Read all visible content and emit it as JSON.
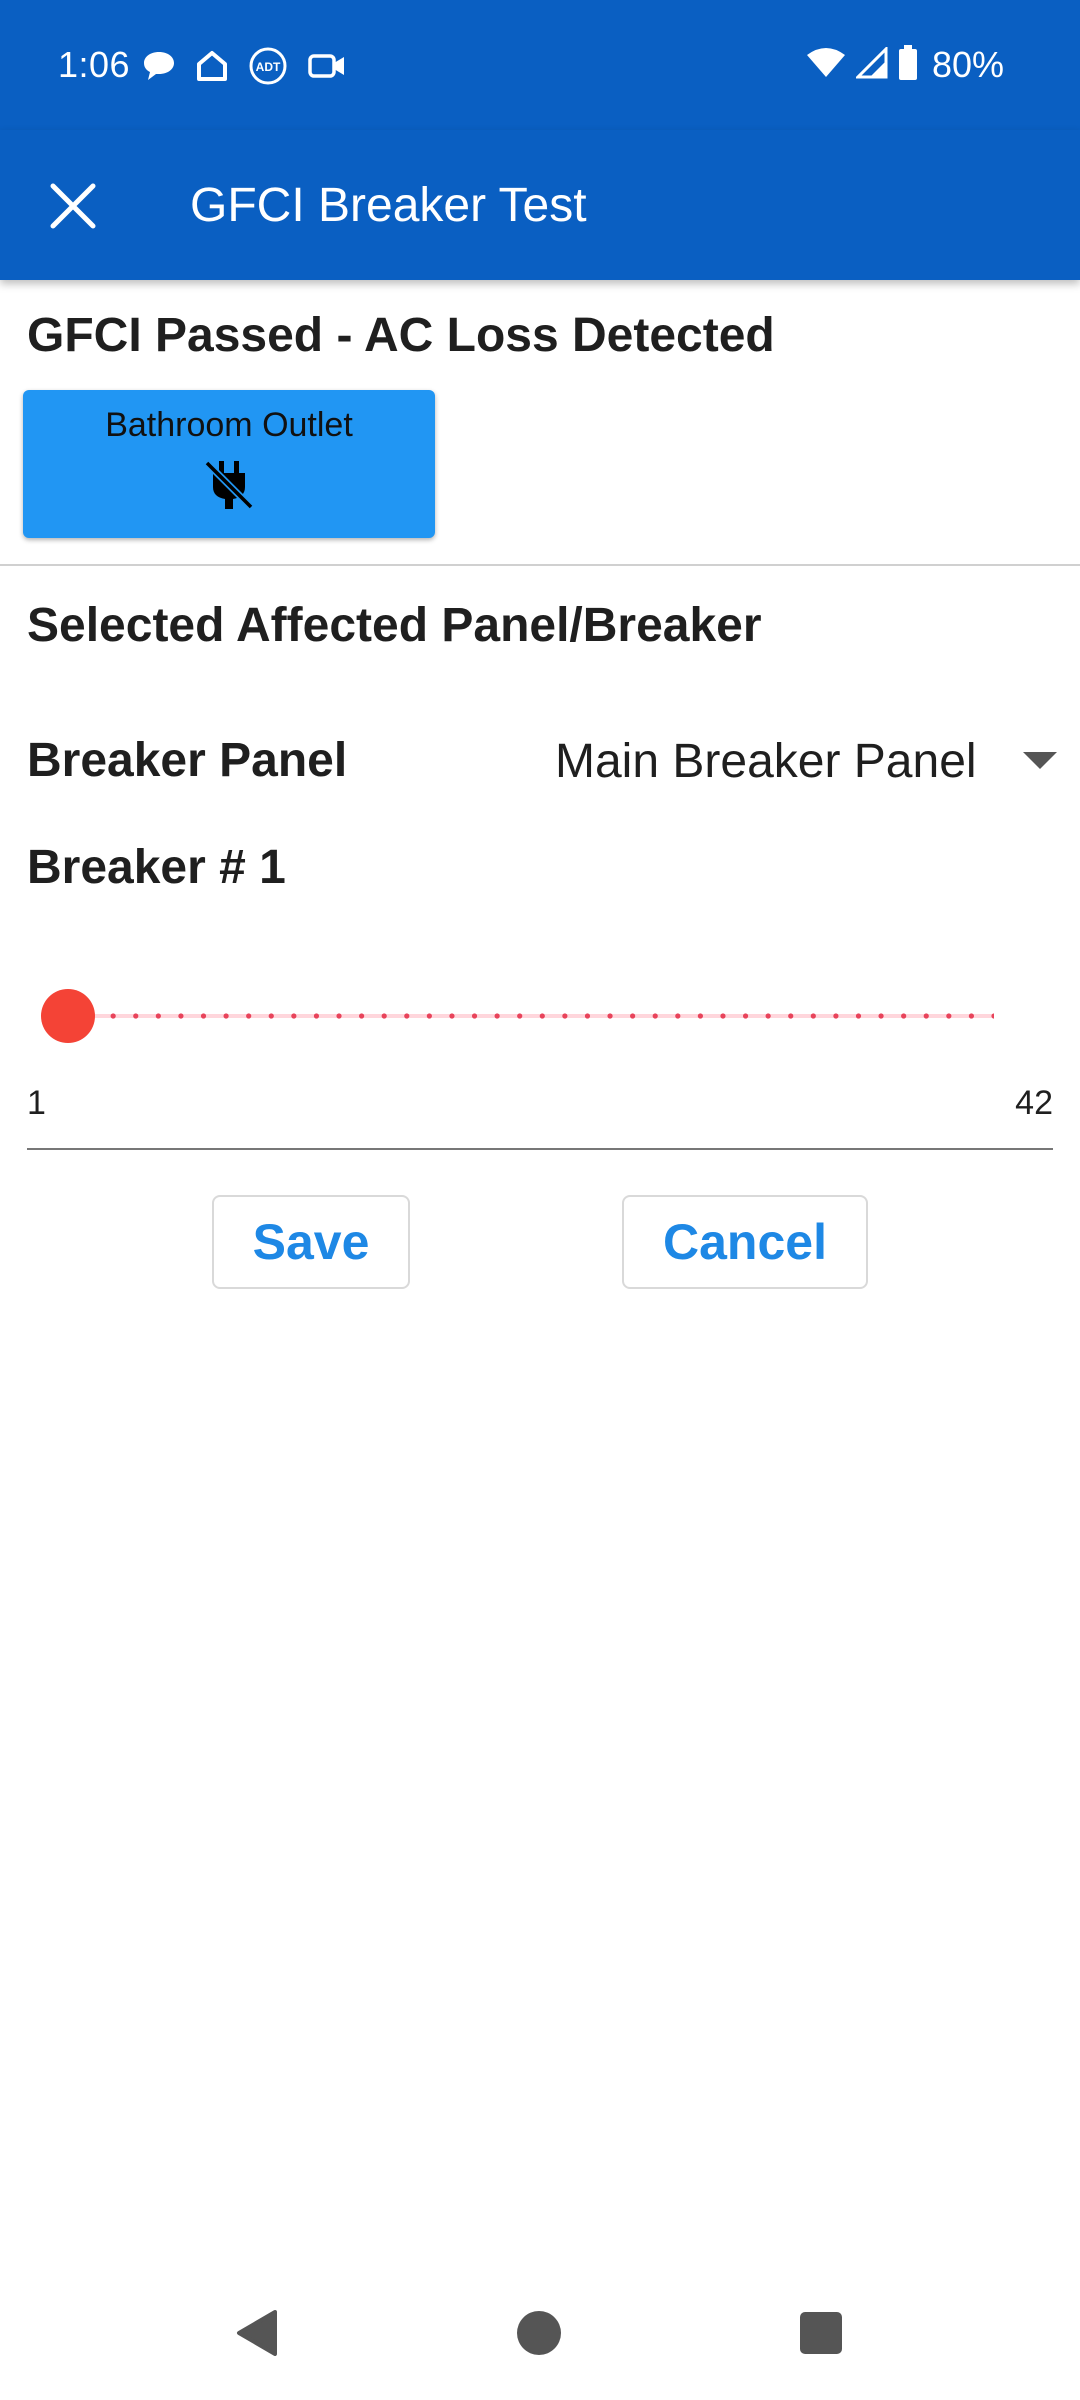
{
  "status_bar": {
    "time": "1:06",
    "battery": "80%",
    "left_icons": [
      "chat-bubble-icon",
      "home-icon",
      "adt-icon",
      "video-camera-icon"
    ],
    "right_icons": [
      "wifi-icon",
      "signal-icon",
      "battery-icon"
    ]
  },
  "app_bar": {
    "title": "GFCI Breaker Test",
    "close_icon": "close-icon",
    "background": "#0a5fc2"
  },
  "result": {
    "heading": "GFCI Passed - AC Loss Detected",
    "outlet": {
      "label": "Bathroom Outlet",
      "icon": "power-off-plug-icon",
      "color": "#2196f3"
    }
  },
  "section": {
    "heading": "Selected Affected Panel/Breaker"
  },
  "breaker_panel": {
    "label": "Breaker Panel",
    "selected": "Main Breaker Panel"
  },
  "breaker": {
    "label": "Breaker # 1",
    "value": 1,
    "min": 1,
    "max": 42,
    "min_label": "1",
    "max_label": "42",
    "thumb_color": "#f44336"
  },
  "actions": {
    "save_label": "Save",
    "cancel_label": "Cancel",
    "accent": "#1e88e5"
  },
  "nav": {
    "back_icon": "back-triangle-icon",
    "home_icon": "home-circle-icon",
    "recents_icon": "recents-square-icon"
  }
}
